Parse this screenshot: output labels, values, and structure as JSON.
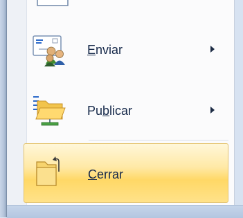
{
  "menu": {
    "items": [
      {
        "id": "enviar",
        "label_pre": "",
        "label_ul": "E",
        "label_post": "nviar",
        "has_submenu": true,
        "icon": "send-envelope-people-icon"
      },
      {
        "id": "publicar",
        "label_pre": "Pu",
        "label_ul": "b",
        "label_post": "licar",
        "has_submenu": true,
        "icon": "publish-folder-icon"
      },
      {
        "id": "cerrar",
        "label_pre": "",
        "label_ul": "C",
        "label_post": "errar",
        "has_submenu": false,
        "icon": "close-folder-icon",
        "highlighted": true
      }
    ]
  },
  "colors": {
    "highlight": "#ffd866",
    "frame": "#b4c4da",
    "text": "#16294a"
  }
}
